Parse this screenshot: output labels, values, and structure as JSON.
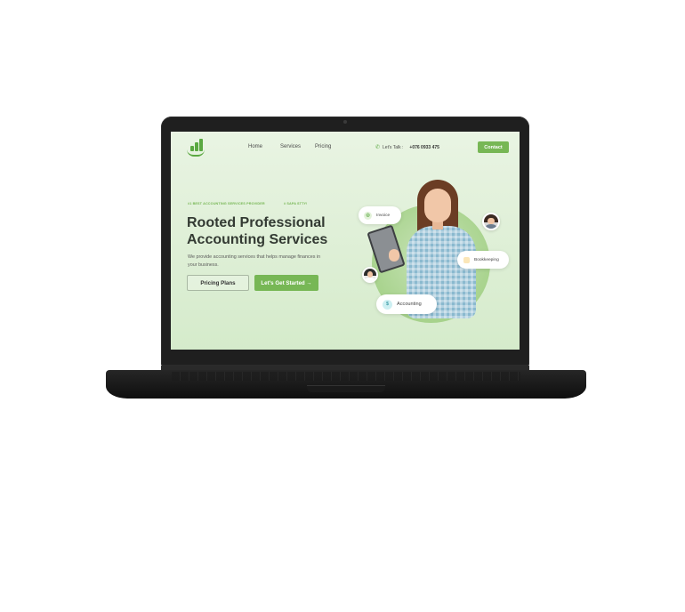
{
  "nav": {
    "home": "Home",
    "services": "Services",
    "pricing": "Pricing",
    "phone_label": "Let's Talk :",
    "phone_number": "+076 0933 475",
    "contact": "Contact"
  },
  "hero": {
    "tag1": "#1 BEST ACCOUNTING SERVICES PROVIDER",
    "tag2": "# SAPA STTY!",
    "headline_line1": "Rooted Professional",
    "headline_line2": "Accounting Services",
    "subtitle": "We provide accounting services that helps manage finances in your business.",
    "btn_plans": "Pricing Plans",
    "btn_start": "Let's Get Started →"
  },
  "illustration": {
    "chip_invoice": "Invoice",
    "chip_bookkeeping": "Bookkeeping",
    "chip_accounting": "Accounting",
    "accounting_symbol": "$"
  },
  "icons": {
    "logo": "bar-chart-logo-icon",
    "phone": "phone-icon",
    "invoice": "invoice-icon",
    "bookkeeping": "folder-icon",
    "accounting": "dollar-icon"
  },
  "colors": {
    "brand_green": "#77b755",
    "hero_bg": "#e9f4e3",
    "laptop_body": "#1f1f1f"
  }
}
